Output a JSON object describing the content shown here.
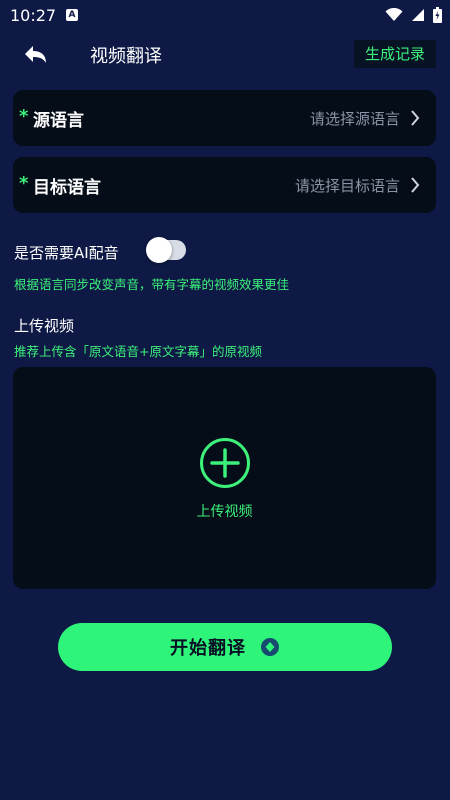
{
  "status_bar": {
    "time": "10:27",
    "icons": [
      "a-notification-icon",
      "wifi-icon",
      "signal-icon",
      "battery-icon"
    ]
  },
  "header": {
    "back_icon": "back-arrow-icon",
    "title": "视频翻译",
    "records_label": "生成记录"
  },
  "form": {
    "source": {
      "required_mark": "*",
      "label": "源语言",
      "placeholder": "请选择源语言"
    },
    "target": {
      "required_mark": "*",
      "label": "目标语言",
      "placeholder": "请选择目标语言"
    },
    "ai_dubbing": {
      "label": "是否需要AI配音",
      "enabled": false,
      "hint": "根据语言同步改变声音，带有字幕的视频效果更佳"
    }
  },
  "upload": {
    "title": "上传视频",
    "hint": "推荐上传含「原文语音+原文字幕」的原视频",
    "button_label": "上传视频",
    "icon": "plus-circle-icon"
  },
  "action": {
    "start_label": "开始翻译",
    "icon": "diamond-badge-icon"
  },
  "colors": {
    "background": "#0e1a45",
    "card": "#050d18",
    "accent": "#3cf07a",
    "button": "#2ef57a"
  }
}
